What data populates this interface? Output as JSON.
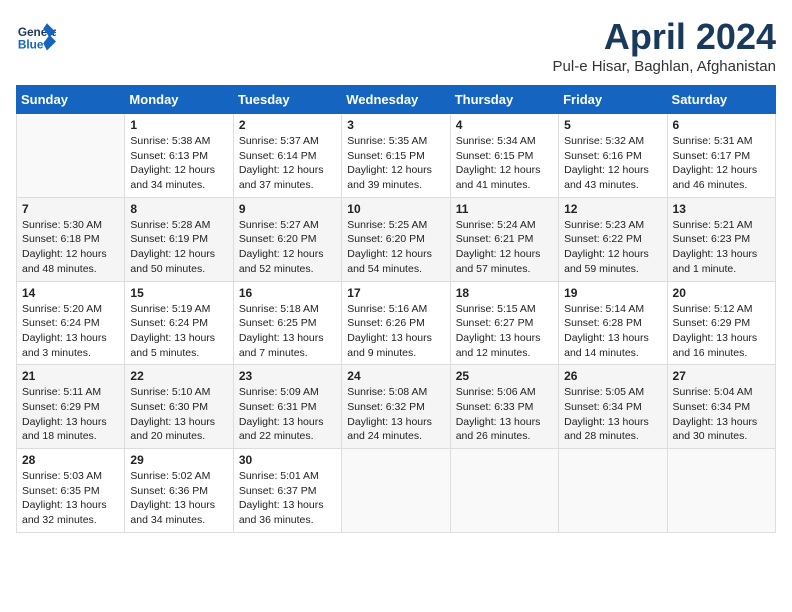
{
  "header": {
    "logo_text_general": "General",
    "logo_text_blue": "Blue",
    "month_title": "April 2024",
    "location": "Pul-e Hisar, Baghlan, Afghanistan"
  },
  "days_of_week": [
    "Sunday",
    "Monday",
    "Tuesday",
    "Wednesday",
    "Thursday",
    "Friday",
    "Saturday"
  ],
  "weeks": [
    [
      {
        "day": "",
        "info": ""
      },
      {
        "day": "1",
        "info": "Sunrise: 5:38 AM\nSunset: 6:13 PM\nDaylight: 12 hours\nand 34 minutes."
      },
      {
        "day": "2",
        "info": "Sunrise: 5:37 AM\nSunset: 6:14 PM\nDaylight: 12 hours\nand 37 minutes."
      },
      {
        "day": "3",
        "info": "Sunrise: 5:35 AM\nSunset: 6:15 PM\nDaylight: 12 hours\nand 39 minutes."
      },
      {
        "day": "4",
        "info": "Sunrise: 5:34 AM\nSunset: 6:15 PM\nDaylight: 12 hours\nand 41 minutes."
      },
      {
        "day": "5",
        "info": "Sunrise: 5:32 AM\nSunset: 6:16 PM\nDaylight: 12 hours\nand 43 minutes."
      },
      {
        "day": "6",
        "info": "Sunrise: 5:31 AM\nSunset: 6:17 PM\nDaylight: 12 hours\nand 46 minutes."
      }
    ],
    [
      {
        "day": "7",
        "info": "Sunrise: 5:30 AM\nSunset: 6:18 PM\nDaylight: 12 hours\nand 48 minutes."
      },
      {
        "day": "8",
        "info": "Sunrise: 5:28 AM\nSunset: 6:19 PM\nDaylight: 12 hours\nand 50 minutes."
      },
      {
        "day": "9",
        "info": "Sunrise: 5:27 AM\nSunset: 6:20 PM\nDaylight: 12 hours\nand 52 minutes."
      },
      {
        "day": "10",
        "info": "Sunrise: 5:25 AM\nSunset: 6:20 PM\nDaylight: 12 hours\nand 54 minutes."
      },
      {
        "day": "11",
        "info": "Sunrise: 5:24 AM\nSunset: 6:21 PM\nDaylight: 12 hours\nand 57 minutes."
      },
      {
        "day": "12",
        "info": "Sunrise: 5:23 AM\nSunset: 6:22 PM\nDaylight: 12 hours\nand 59 minutes."
      },
      {
        "day": "13",
        "info": "Sunrise: 5:21 AM\nSunset: 6:23 PM\nDaylight: 13 hours\nand 1 minute."
      }
    ],
    [
      {
        "day": "14",
        "info": "Sunrise: 5:20 AM\nSunset: 6:24 PM\nDaylight: 13 hours\nand 3 minutes."
      },
      {
        "day": "15",
        "info": "Sunrise: 5:19 AM\nSunset: 6:24 PM\nDaylight: 13 hours\nand 5 minutes."
      },
      {
        "day": "16",
        "info": "Sunrise: 5:18 AM\nSunset: 6:25 PM\nDaylight: 13 hours\nand 7 minutes."
      },
      {
        "day": "17",
        "info": "Sunrise: 5:16 AM\nSunset: 6:26 PM\nDaylight: 13 hours\nand 9 minutes."
      },
      {
        "day": "18",
        "info": "Sunrise: 5:15 AM\nSunset: 6:27 PM\nDaylight: 13 hours\nand 12 minutes."
      },
      {
        "day": "19",
        "info": "Sunrise: 5:14 AM\nSunset: 6:28 PM\nDaylight: 13 hours\nand 14 minutes."
      },
      {
        "day": "20",
        "info": "Sunrise: 5:12 AM\nSunset: 6:29 PM\nDaylight: 13 hours\nand 16 minutes."
      }
    ],
    [
      {
        "day": "21",
        "info": "Sunrise: 5:11 AM\nSunset: 6:29 PM\nDaylight: 13 hours\nand 18 minutes."
      },
      {
        "day": "22",
        "info": "Sunrise: 5:10 AM\nSunset: 6:30 PM\nDaylight: 13 hours\nand 20 minutes."
      },
      {
        "day": "23",
        "info": "Sunrise: 5:09 AM\nSunset: 6:31 PM\nDaylight: 13 hours\nand 22 minutes."
      },
      {
        "day": "24",
        "info": "Sunrise: 5:08 AM\nSunset: 6:32 PM\nDaylight: 13 hours\nand 24 minutes."
      },
      {
        "day": "25",
        "info": "Sunrise: 5:06 AM\nSunset: 6:33 PM\nDaylight: 13 hours\nand 26 minutes."
      },
      {
        "day": "26",
        "info": "Sunrise: 5:05 AM\nSunset: 6:34 PM\nDaylight: 13 hours\nand 28 minutes."
      },
      {
        "day": "27",
        "info": "Sunrise: 5:04 AM\nSunset: 6:34 PM\nDaylight: 13 hours\nand 30 minutes."
      }
    ],
    [
      {
        "day": "28",
        "info": "Sunrise: 5:03 AM\nSunset: 6:35 PM\nDaylight: 13 hours\nand 32 minutes."
      },
      {
        "day": "29",
        "info": "Sunrise: 5:02 AM\nSunset: 6:36 PM\nDaylight: 13 hours\nand 34 minutes."
      },
      {
        "day": "30",
        "info": "Sunrise: 5:01 AM\nSunset: 6:37 PM\nDaylight: 13 hours\nand 36 minutes."
      },
      {
        "day": "",
        "info": ""
      },
      {
        "day": "",
        "info": ""
      },
      {
        "day": "",
        "info": ""
      },
      {
        "day": "",
        "info": ""
      }
    ]
  ]
}
